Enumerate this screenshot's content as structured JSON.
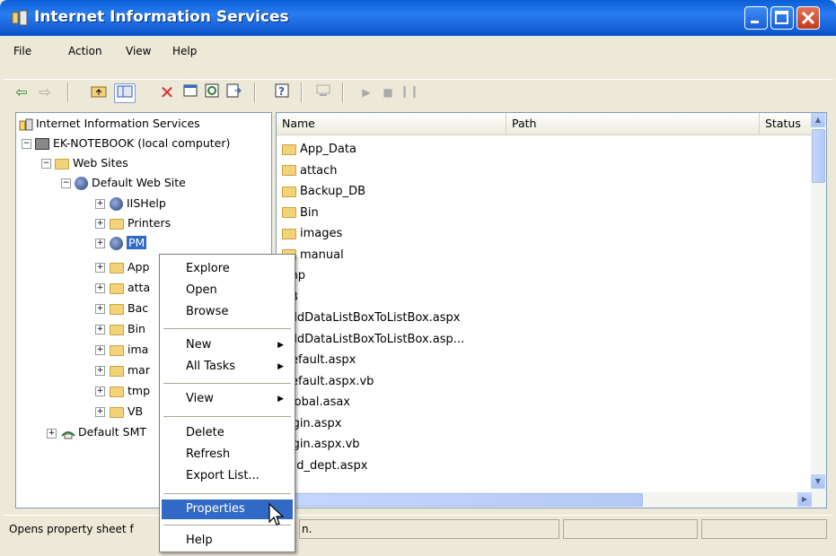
{
  "window": {
    "title": "Internet Information Services"
  },
  "menu": [
    "File",
    "Action",
    "View",
    "Help"
  ],
  "toolbar_icons": [
    "back-icon",
    "forward-icon",
    "up-folder-icon",
    "show-tree-icon",
    "delete-icon",
    "properties-icon",
    "refresh-icon",
    "export-icon",
    "help-icon",
    "computer-icon",
    "play-icon",
    "stop-icon",
    "pause-icon"
  ],
  "tree": {
    "root": "Internet Information Services",
    "computer": "EK-NOTEBOOK (local computer)",
    "web_sites": "Web Sites",
    "default_web_site": "Default Web Site",
    "apps": [
      "IISHelp",
      "Printers",
      "PM"
    ],
    "folders": [
      "App",
      "atta",
      "Bac",
      "Bin",
      "ima",
      "mar",
      "tmp",
      "VB"
    ],
    "smtp": "Default SMT"
  },
  "list": {
    "columns": [
      "Name",
      "Path",
      "Status"
    ],
    "items": [
      {
        "name": "App_Data",
        "type": "folder"
      },
      {
        "name": "attach",
        "type": "folder"
      },
      {
        "name": "Backup_DB",
        "type": "folder"
      },
      {
        "name": "Bin",
        "type": "folder"
      },
      {
        "name": "images",
        "type": "folder"
      },
      {
        "name": "manual",
        "type": "folder"
      },
      {
        "name": "tmp",
        "type": "file"
      },
      {
        "name": "VB",
        "type": "file"
      },
      {
        "name": "AddDataListBoxToListBox.aspx",
        "type": "file"
      },
      {
        "name": "AddDataListBoxToListBox.asp...",
        "type": "file"
      },
      {
        "name": "Default.aspx",
        "type": "file"
      },
      {
        "name": "Default.aspx.vb",
        "type": "file"
      },
      {
        "name": "Global.asax",
        "type": "file"
      },
      {
        "name": "login.aspx",
        "type": "file"
      },
      {
        "name": "login.aspx.vb",
        "type": "file"
      },
      {
        "name": "add_dept.aspx",
        "type": "file"
      }
    ]
  },
  "context_menu": {
    "explore": "Explore",
    "open": "Open",
    "browse": "Browse",
    "new": "New",
    "all_tasks": "All Tasks",
    "view": "View",
    "delete": "Delete",
    "refresh": "Refresh",
    "export_list": "Export List...",
    "properties": "Properties",
    "help": "Help"
  },
  "status": {
    "text": "Opens property sheet f",
    "right_text": "n."
  }
}
